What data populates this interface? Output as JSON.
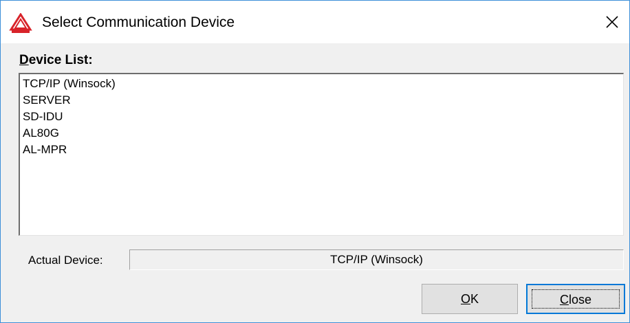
{
  "window": {
    "title": "Select Communication Device",
    "close_glyph": "✕",
    "logo_icon": "alcohol-tester-logo-icon"
  },
  "device_list": {
    "label_underlined": "D",
    "label_rest": "evice List:",
    "items": [
      "TCP/IP (Winsock)",
      "SERVER",
      "SD-IDU",
      "AL80G",
      "AL-MPR"
    ]
  },
  "actual_device": {
    "label": "Actual Device:",
    "value": "TCP/IP (Winsock)"
  },
  "buttons": {
    "ok_underlined": "O",
    "ok_rest": "K",
    "close_underlined": "C",
    "close_rest": "lose"
  },
  "colors": {
    "window_border": "#3c8fd8",
    "logo_red": "#d8232a",
    "focus_blue": "#0078d7"
  }
}
